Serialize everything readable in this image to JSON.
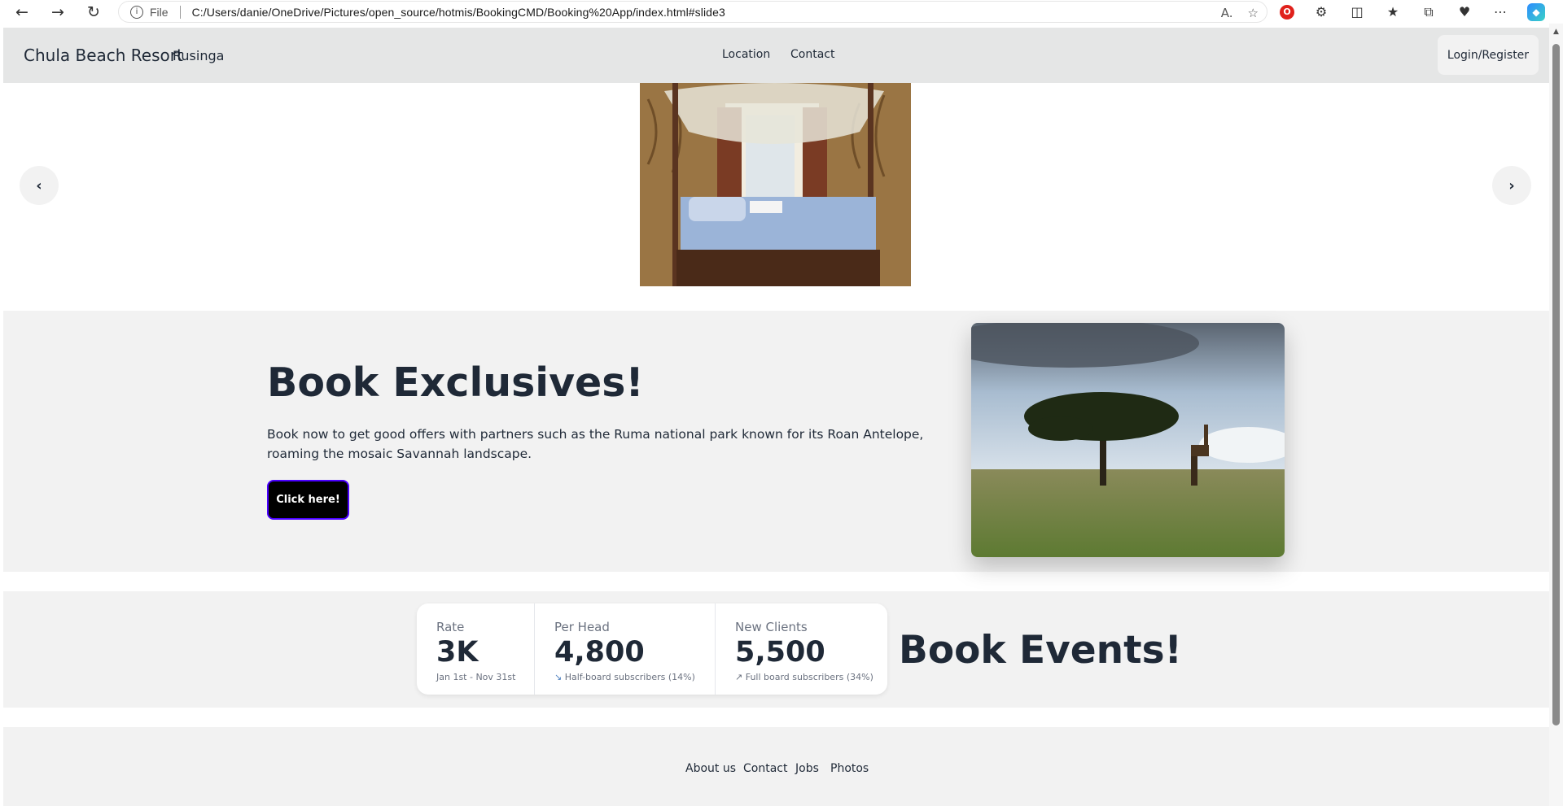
{
  "browser": {
    "url_scheme": "File",
    "url": "C:/Users/danie/OneDrive/Pictures/open_source/hotmis/BookingCMD/Booking%20App/index.html#slide3"
  },
  "navbar": {
    "brand": "Chula Beach Resort",
    "brand_sub": "Rusinga",
    "links": [
      "Location",
      "Contact"
    ],
    "login_label": "Login/Register"
  },
  "carousel": {
    "prev_glyph": "‹",
    "next_glyph": "›"
  },
  "hero": {
    "title": "Book Exclusives!",
    "text": "Book now to get good offers with partners such as the Ruma national park known for its Roan Antelope, roaming the mosaic Savannah landscape.",
    "button_label": "Click here!"
  },
  "stats": [
    {
      "title": "Rate",
      "value": "3K",
      "desc": "Jan 1st - Nov 31st"
    },
    {
      "title": "Per Head",
      "value": "4,800",
      "desc": "Half-board subscribers (14%)"
    },
    {
      "title": "New Clients",
      "value": "5,500",
      "desc": "Full board subscribers (34%)"
    }
  ],
  "events_title": "Book Events!",
  "footer": {
    "links": [
      "About us",
      "Contact",
      "Jobs",
      "Photos"
    ]
  },
  "colors": {
    "navbar_bg": "#e5e6e6",
    "section_bg": "#f2f2f2",
    "text": "#1f2937",
    "button_bg": "#000000",
    "button_border": "#4a00ff"
  }
}
